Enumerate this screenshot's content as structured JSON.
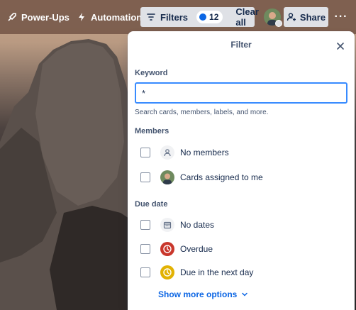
{
  "topbar": {
    "powerups_label": "Power-Ups",
    "automation_label": "Automation",
    "filters_label": "Filters",
    "filter_count": "12",
    "clear_all_label": "Clear all",
    "share_label": "Share",
    "more_label": "···"
  },
  "filter_panel": {
    "title": "Filter",
    "keyword": {
      "label": "Keyword",
      "value": "*",
      "hint": "Search cards, members, labels, and more."
    },
    "members": {
      "label": "Members",
      "options": [
        {
          "label": "No members",
          "icon": "person-icon",
          "checked": false
        },
        {
          "label": "Cards assigned to me",
          "icon": "avatar",
          "checked": false
        }
      ]
    },
    "due_date": {
      "label": "Due date",
      "options": [
        {
          "label": "No dates",
          "icon": "calendar-icon",
          "checked": false
        },
        {
          "label": "Overdue",
          "icon": "clock-icon",
          "icon_color": "#c9372c",
          "checked": false
        },
        {
          "label": "Due in the next day",
          "icon": "clock-icon",
          "icon_color": "#e2b203",
          "checked": false
        }
      ]
    },
    "show_more_label": "Show more options"
  },
  "colors": {
    "accent": "#0c66e4",
    "input_focus": "#388bff",
    "overdue": "#c9372c",
    "due_soon": "#e2b203"
  }
}
